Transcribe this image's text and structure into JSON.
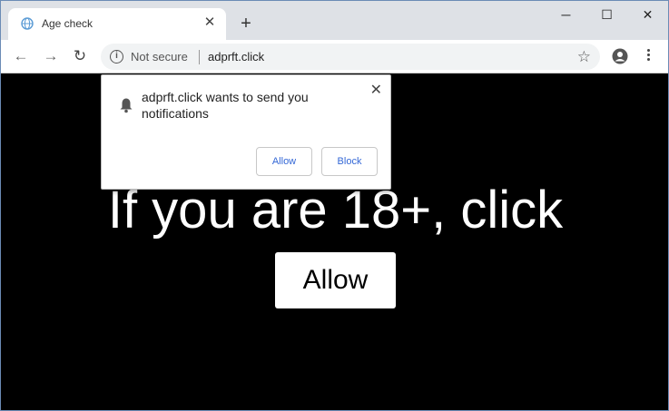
{
  "tab": {
    "title": "Age check",
    "close_symbol": "✕",
    "favicon": "globe-icon"
  },
  "new_tab_symbol": "+",
  "window_controls": {
    "minimize": "─",
    "maximize": "☐",
    "close": "✕"
  },
  "toolbar": {
    "back_symbol": "←",
    "forward_symbol": "→",
    "reload_symbol": "↻",
    "security_label": "Not secure",
    "url": "adprft.click",
    "bookmark_symbol": "☆"
  },
  "popup": {
    "message": "adprft.click wants to send you notifications",
    "allow_label": "Allow",
    "block_label": "Block",
    "close_symbol": "✕"
  },
  "page": {
    "headline": "If you are 18+, click",
    "allow_button": "Allow"
  },
  "colors": {
    "tabstrip": "#dee1e6",
    "page_background": "#000000",
    "popup_button_text": "#3367d6"
  }
}
